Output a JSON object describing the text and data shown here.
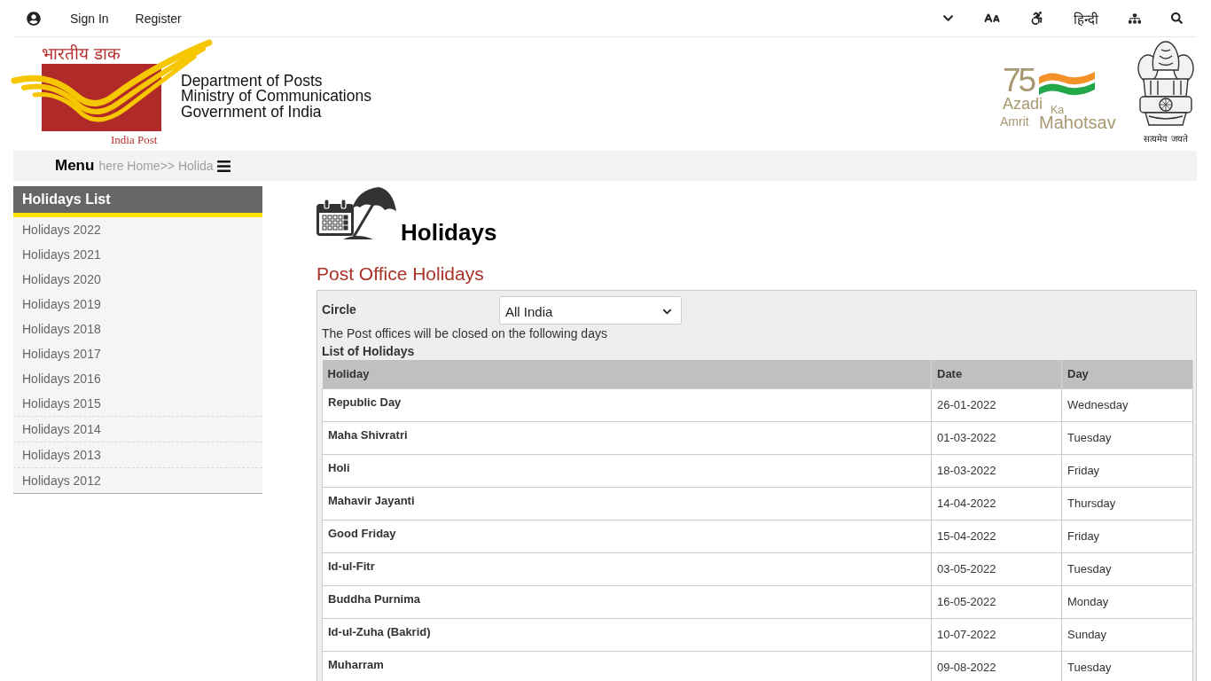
{
  "top_bar": {
    "account_links": [
      "Sign In",
      "Register"
    ],
    "language_link": "हिन्दी"
  },
  "header": {
    "logo": {
      "hindi_name": "भारतीय डाक",
      "english_name": "India Post"
    },
    "org_lines": [
      "Department of Posts",
      "Ministry of Communications",
      "Government of India"
    ],
    "campaign_logo": {
      "number": "75",
      "lines": [
        [
          "Azadi",
          "Ka"
        ],
        [
          "Amrit",
          "Mahotsav"
        ]
      ]
    },
    "emblem_motto": "सत्यमेव जयते"
  },
  "nav": {
    "menu_label": "Menu",
    "breadcrumb": "here Home>> Holida"
  },
  "sidebar": {
    "title": "Holidays List",
    "items": [
      {
        "label": "Holidays 2022",
        "selected": false
      },
      {
        "label": "Holidays 2021",
        "selected": false
      },
      {
        "label": "Holidays 2020",
        "selected": false
      },
      {
        "label": "Holidays 2019",
        "selected": false
      },
      {
        "label": "Holidays 2018",
        "selected": false
      },
      {
        "label": "Holidays 2017",
        "selected": false
      },
      {
        "label": "Holidays 2016",
        "selected": false
      },
      {
        "label": "Holidays 2015",
        "selected": false
      },
      {
        "label": "Holidays 2014",
        "selected": false
      },
      {
        "label": "Holidays 2013",
        "selected": false
      },
      {
        "label": "Holidays 2012",
        "selected": false
      }
    ]
  },
  "content": {
    "title": "Holidays",
    "section_title": "Post Office Holidays",
    "filter": {
      "label": "Circle",
      "value": "All India"
    },
    "note": "The Post offices will be closed on the following days",
    "table": {
      "caption": "List of Holidays",
      "columns": [
        "Holiday",
        "Date",
        "Day"
      ],
      "rows": [
        {
          "holiday": "Republic Day",
          "date": "26-01-2022",
          "day": "Wednesday"
        },
        {
          "holiday": "Maha Shivratri",
          "date": "01-03-2022",
          "day": "Tuesday"
        },
        {
          "holiday": "Holi",
          "date": "18-03-2022",
          "day": "Friday"
        },
        {
          "holiday": "Mahavir Jayanti",
          "date": "14-04-2022",
          "day": "Thursday"
        },
        {
          "holiday": "Good Friday",
          "date": "15-04-2022",
          "day": "Friday"
        },
        {
          "holiday": "Id-ul-Fitr",
          "date": "03-05-2022",
          "day": "Tuesday"
        },
        {
          "holiday": "Buddha Purnima",
          "date": "16-05-2022",
          "day": "Monday"
        },
        {
          "holiday": "Id-ul-Zuha (Bakrid)",
          "date": "10-07-2022",
          "day": "Sunday"
        },
        {
          "holiday": "Muharram",
          "date": "09-08-2022",
          "day": "Tuesday"
        }
      ]
    }
  }
}
